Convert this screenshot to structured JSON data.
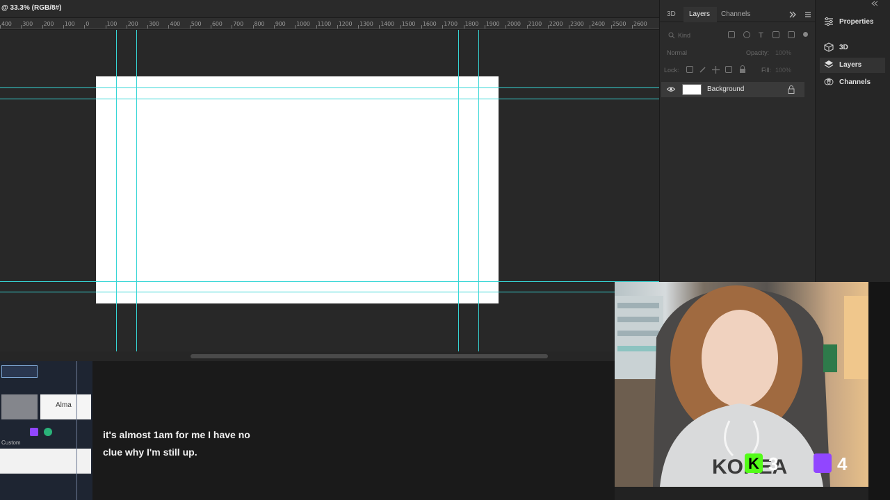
{
  "document": {
    "tab_title": "@ 33.3% (RGB/8#)",
    "ruler_labels": [
      "400",
      "300",
      "200",
      "100",
      "0",
      "100",
      "200",
      "300",
      "400",
      "500",
      "600",
      "700",
      "800",
      "900",
      "1000",
      "1100",
      "1200",
      "1300",
      "1400",
      "1500",
      "1600",
      "1700",
      "1800",
      "1900",
      "2000",
      "2100",
      "2200",
      "2300",
      "2400",
      "2500",
      "2600"
    ],
    "artboard_color": "#ffffff",
    "guide_color": "#36d6d6"
  },
  "layers_panel": {
    "tabs": [
      "3D",
      "Layers",
      "Channels"
    ],
    "active_tab": "Layers",
    "filter_placeholder": "Kind",
    "blend_mode": "Normal",
    "opacity_label": "Opacity:",
    "opacity_value": "100%",
    "lock_label": "Lock:",
    "fill_label": "Fill:",
    "fill_value": "100%",
    "layers": [
      {
        "name": "Background",
        "visible": true,
        "locked": true
      }
    ]
  },
  "properties_panel": {
    "items": [
      {
        "label": "Properties",
        "icon": "sliders-icon"
      },
      {
        "label": "3D",
        "icon": "cube-icon"
      },
      {
        "label": "Layers",
        "icon": "layers-icon"
      },
      {
        "label": "Channels",
        "icon": "channels-icon"
      }
    ]
  },
  "obs": {
    "scene_label": "Alma",
    "custom_label": "Custom"
  },
  "chat": {
    "message": "it's almost 1am for me I have no clue why I'm still up."
  },
  "webcam": {
    "kick_count": "3",
    "twitch_count": "4",
    "kick_color": "#53fc18",
    "twitch_color": "#9146ff"
  }
}
